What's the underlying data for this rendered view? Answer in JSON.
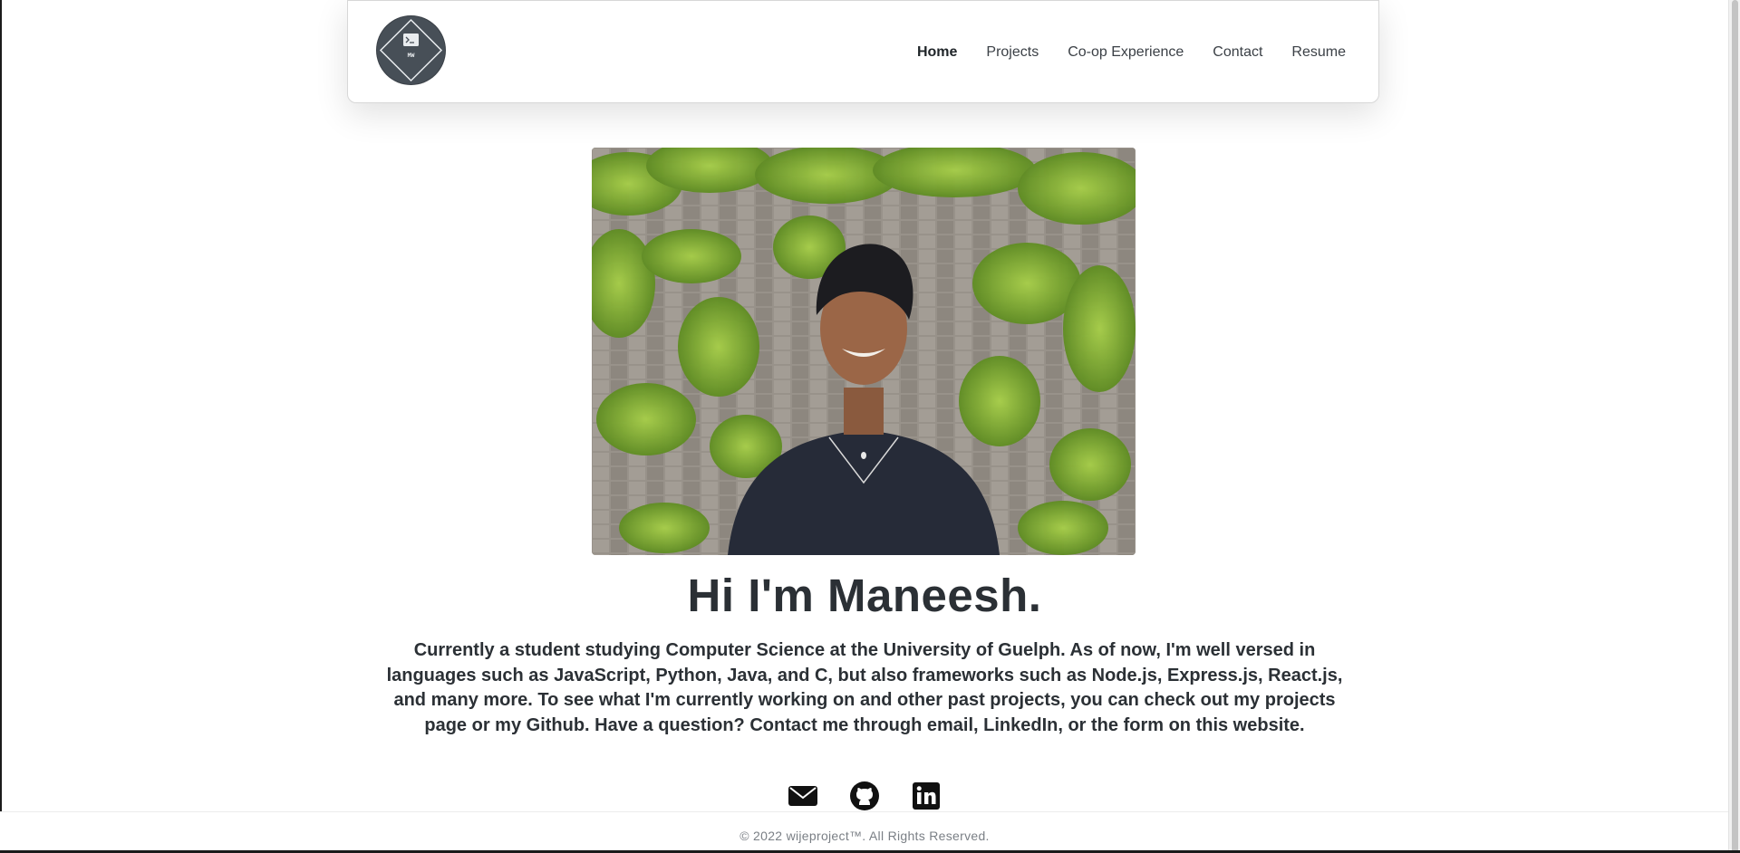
{
  "logo": {
    "initials": "MW",
    "icon": "terminal-icon"
  },
  "nav": {
    "items": [
      {
        "label": "Home",
        "active": true
      },
      {
        "label": "Projects",
        "active": false
      },
      {
        "label": "Co-op Experience",
        "active": false
      },
      {
        "label": "Contact",
        "active": false
      },
      {
        "label": "Resume",
        "active": false
      }
    ]
  },
  "hero": {
    "photo_alt": "Portrait photo",
    "headline": "Hi I'm Maneesh.",
    "bio": "Currently a student studying Computer Science at the University of Guelph. As of now, I'm well versed in languages such as JavaScript, Python, Java, and C, but also frameworks such as Node.js, Express.js, React.js, and many more. To see what I'm currently working on and other past projects, you can check out my projects page or my Github. Have a question? Contact me through email, LinkedIn, or the form on this website."
  },
  "social": [
    {
      "icon": "email-icon"
    },
    {
      "icon": "github-icon"
    },
    {
      "icon": "linkedin-icon"
    }
  ],
  "footer": {
    "text": "© 2022 wijeproject™. All Rights Reserved."
  },
  "colors": {
    "text": "#2b3035",
    "logo_bg": "#474f57",
    "footer_text": "#7a7f85"
  }
}
